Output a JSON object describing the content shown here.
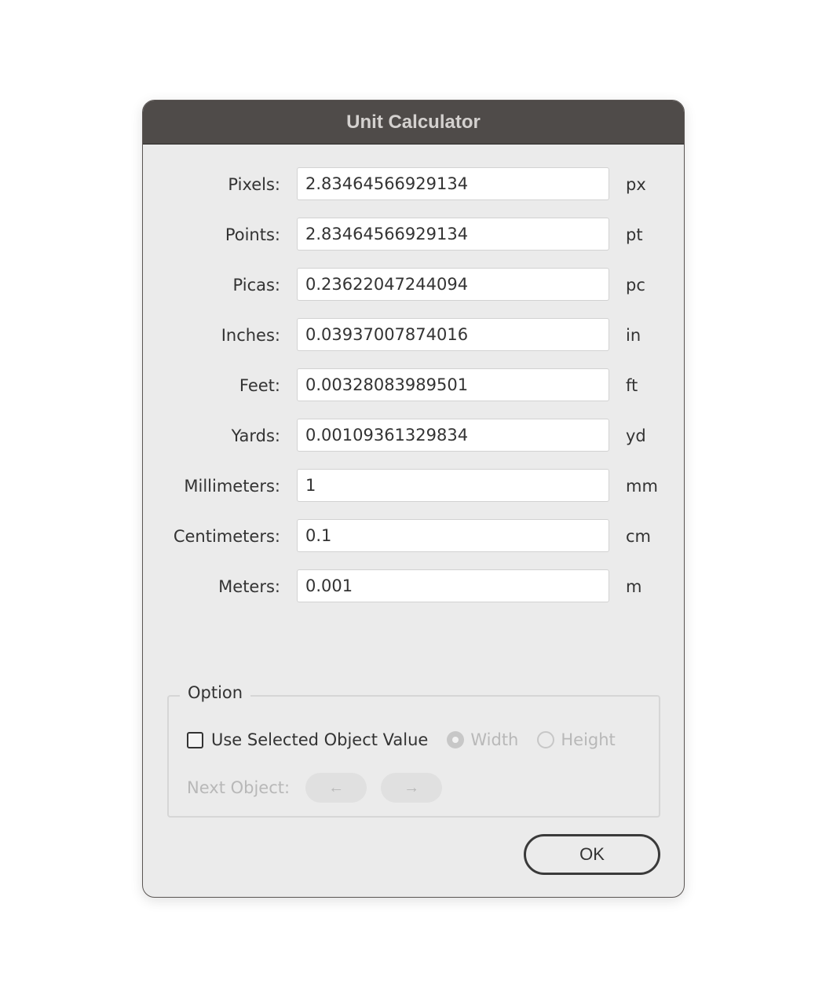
{
  "dialog": {
    "title": "Unit Calculator",
    "fields": [
      {
        "label": "Pixels:",
        "value": "2.83464566929134",
        "unit": "px"
      },
      {
        "label": "Points:",
        "value": "2.83464566929134",
        "unit": "pt"
      },
      {
        "label": "Picas:",
        "value": "0.23622047244094",
        "unit": "pc"
      },
      {
        "label": "Inches:",
        "value": "0.03937007874016",
        "unit": "in"
      },
      {
        "label": "Feet:",
        "value": "0.00328083989501",
        "unit": "ft"
      },
      {
        "label": "Yards:",
        "value": "0.00109361329834",
        "unit": "yd"
      },
      {
        "label": "Millimeters:",
        "value": "1",
        "unit": "mm"
      },
      {
        "label": "Centimeters:",
        "value": "0.1",
        "unit": "cm"
      },
      {
        "label": "Meters:",
        "value": "0.001",
        "unit": "m"
      }
    ],
    "option": {
      "legend": "Option",
      "use_selected_label": "Use Selected Object Value",
      "use_selected_checked": false,
      "width_label": "Width",
      "width_selected": true,
      "height_label": "Height",
      "height_selected": false,
      "next_object_label": "Next Object:",
      "prev_arrow": "←",
      "next_arrow": "→"
    },
    "ok_label": "OK"
  }
}
